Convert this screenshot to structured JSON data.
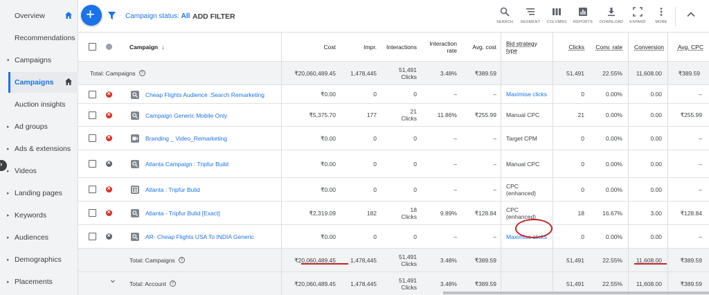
{
  "sidebar": {
    "items": [
      {
        "label": "Overview",
        "caret": "",
        "home": true
      },
      {
        "label": "Recommendations",
        "caret": ""
      },
      {
        "label": "Campaigns",
        "caret": "▾"
      },
      {
        "label": "Campaigns",
        "caret": "",
        "active": true,
        "home": true
      },
      {
        "label": "Auction insights",
        "caret": ""
      },
      {
        "label": "Ad groups",
        "caret": "▸"
      },
      {
        "label": "Ads & extensions",
        "caret": "▸"
      },
      {
        "label": "Videos",
        "caret": "▸"
      },
      {
        "label": "Landing pages",
        "caret": "▸"
      },
      {
        "label": "Keywords",
        "caret": "▸"
      },
      {
        "label": "Audiences",
        "caret": "▸"
      },
      {
        "label": "Demographics",
        "caret": "▸"
      },
      {
        "label": "Placements",
        "caret": "▸"
      }
    ]
  },
  "toolbar": {
    "status_prefix": "Campaign status:",
    "status_value": "All",
    "add_filter": "ADD FILTER",
    "tools": [
      "SEARCH",
      "SEGMENT",
      "COLUMNS",
      "REPORTS",
      "DOWNLOAD",
      "EXPAND",
      "MORE"
    ]
  },
  "table": {
    "headers": {
      "campaign": "Campaign",
      "cost": "Cost",
      "impr": "Impr.",
      "interactions": "Interactions",
      "interaction_rate": "Interaction rate",
      "avg_cost": "Avg. cost",
      "bid_strategy": "Bid strategy type",
      "clicks": "Clicks",
      "conv_rate": "Conv. rate",
      "conversion": "Conversion",
      "avg_cpc": "Avg. CPC"
    },
    "top_total": {
      "label": "Total: Campaigns",
      "cost": "₹20,060,489.45",
      "impr": "1,478,445",
      "interactions": "51,491",
      "interactions_unit": "Clicks",
      "interaction_rate": "3.48%",
      "avg_cost": "₹389.59",
      "bid_strategy": "",
      "clicks": "51,491",
      "conv_rate": "22.55%",
      "conversion": "11,608.00",
      "avg_cpc": "₹389.59"
    },
    "rows": [
      {
        "status": "removed",
        "type": "search",
        "name": "Cheap Flights Audience :Search Remarketing",
        "cost": "₹0.00",
        "impr": "0",
        "interactions": "0",
        "interactions_unit": "",
        "interaction_rate": "–",
        "avg_cost": "–",
        "bid_strategy": "Maximise clicks",
        "bid_link": true,
        "clicks": "0",
        "conv_rate": "0.00%",
        "conversion": "0.00",
        "avg_cpc": "–"
      },
      {
        "status": "removed",
        "type": "search",
        "name": "Campaign Generic Mobile Only",
        "cost": "₹5,375.70",
        "impr": "177",
        "interactions": "21",
        "interactions_unit": "Clicks",
        "interaction_rate": "11.86%",
        "avg_cost": "₹255.99",
        "bid_strategy": "Manual CPC",
        "bid_link": false,
        "clicks": "21",
        "conv_rate": "0.00%",
        "conversion": "0.00",
        "avg_cpc": "₹255.99"
      },
      {
        "status": "removed",
        "type": "video",
        "name": "Branding _ Video_Remarketing",
        "cost": "₹0.00",
        "impr": "0",
        "interactions": "0",
        "interactions_unit": "",
        "interaction_rate": "–",
        "avg_cost": "–",
        "bid_strategy": "Target CPM",
        "bid_link": false,
        "clicks": "0",
        "conv_rate": "0.00%",
        "conversion": "0.00",
        "avg_cpc": "–"
      },
      {
        "status": "paused",
        "type": "search",
        "name": "Atlanta Campaign : Tripfur Build",
        "cost": "₹0.00",
        "impr": "0",
        "interactions": "0",
        "interactions_unit": "",
        "interaction_rate": "–",
        "avg_cost": "–",
        "bid_strategy": "Manual CPC",
        "bid_link": false,
        "clicks": "0",
        "conv_rate": "0.00%",
        "conversion": "0.00",
        "avg_cpc": "–"
      },
      {
        "status": "removed",
        "type": "display",
        "name": "Atlanta : Tripfur Bulid",
        "cost": "₹0.00",
        "impr": "0",
        "interactions": "0",
        "interactions_unit": "",
        "interaction_rate": "–",
        "avg_cost": "–",
        "bid_strategy": "CPC (enhanced)",
        "bid_link": false,
        "clicks": "0",
        "conv_rate": "0.00%",
        "conversion": "0.00",
        "avg_cpc": "–"
      },
      {
        "status": "removed",
        "type": "search",
        "name": "Atlanta - Tripfur Bulid [Exact]",
        "cost": "₹2,319.09",
        "impr": "182",
        "interactions": "18",
        "interactions_unit": "Clicks",
        "interaction_rate": "9.89%",
        "avg_cost": "₹128.84",
        "bid_strategy": "CPC (enhanced)",
        "bid_link": false,
        "clicks": "18",
        "conv_rate": "16.67%",
        "conversion": "3.00",
        "avg_cpc": "₹128.84"
      },
      {
        "status": "paused",
        "type": "search",
        "name": "AR- Cheap Flights USA To INDIA Generic",
        "cost": "₹0.00",
        "impr": "0",
        "interactions": "0",
        "interactions_unit": "",
        "interaction_rate": "–",
        "avg_cost": "–",
        "bid_strategy": "Maximise clicks",
        "bid_link": true,
        "clicks": "0",
        "conv_rate": "0.00%",
        "conversion": "0.00",
        "avg_cpc": "–"
      }
    ],
    "bottom_totals": [
      {
        "label": "Total: Campaigns",
        "cost": "₹20,060,489.45",
        "impr": "1,478,445",
        "interactions": "51,491",
        "interactions_unit": "Clicks",
        "interaction_rate": "3.48%",
        "avg_cost": "₹389.59",
        "clicks": "51,491",
        "conv_rate": "22.55%",
        "conversion": "11,608.00",
        "avg_cpc": "₹389.59"
      },
      {
        "label": "Total: Account",
        "cost": "₹20,060,489.45",
        "impr": "1,478,445",
        "interactions": "51,491",
        "interactions_unit": "Clicks",
        "interaction_rate": "3.48%",
        "avg_cost": "₹389.59",
        "clicks": "51,491",
        "conv_rate": "22.55%",
        "conversion": "11,608.00",
        "avg_cpc": "₹389.59"
      }
    ]
  },
  "colors": {
    "accent": "#1a73e8",
    "removed": "#d93025",
    "paused": "#5f6368",
    "highlight": "#c5221f"
  }
}
